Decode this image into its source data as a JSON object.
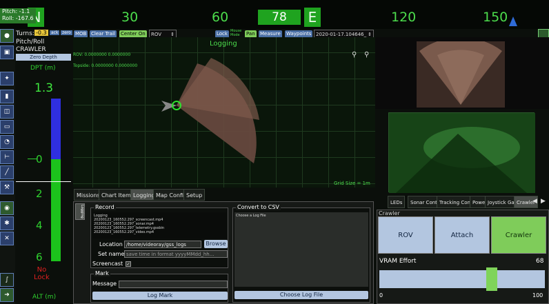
{
  "heading": {
    "ticks": [
      "N",
      "30",
      "60",
      "78",
      "E",
      "120",
      "150"
    ],
    "current": "78"
  },
  "pitchroll": {
    "pitch": "Pitch: -1.1",
    "roll": "Roll: -167.6"
  },
  "top_left": {
    "turns_label": "Turns:",
    "turns_value": "-0.3",
    "ack": "ack",
    "zero": "zero",
    "pitch_roll_label": "Pitch/Roll",
    "crawler_label": "CRAWLER",
    "zero_depth": "Zero Depth",
    "dpt_label": "DPT (m)",
    "depth_value": "1.3",
    "no_lock": "No\nLock",
    "alt_label": "ALT (m)",
    "scale_ticks": [
      "0",
      "2",
      "4",
      "6"
    ]
  },
  "toolbar": {
    "mob": "MOB",
    "clear_trail": "Clear Trail",
    "center_on": "Center On",
    "rov_select": "ROV",
    "lock": "Lock",
    "mouse_mode": "Mouse\nMode",
    "pan": "Pan",
    "measure": "Measure",
    "waypoints": "Waypoints",
    "log_select": "2020-01-17.104646_"
  },
  "map": {
    "logging": "Logging",
    "rov_coords": "ROV: 0.0000000 0.0000000",
    "topside_coords": "Topside: 0.0000000 0.0000000",
    "grid_size": "Grid Size = 1m"
  },
  "tabs": [
    "Missions",
    "Chart Items",
    "Logging",
    "Map Config",
    "Setup"
  ],
  "active_tab": "Logging",
  "logging": {
    "side_tab": "Logging",
    "record_title": "Record",
    "file_list": [
      "Logging",
      "20200123_160552.297_screencast.mp4",
      "20200123_160552.297_sonar.mp4",
      "20200123_160552.297_telemetry.gssbin",
      "20200123_160552.297_video.mp4"
    ],
    "location_label": "Location",
    "location_value": "/home/videoray/gss_logs",
    "browse": "Browse",
    "setname_label": "Set name",
    "setname_placeholder": "save time in format yyyyMMdd_hh...",
    "screencast_label": "Screencast",
    "mark_title": "Mark",
    "message_label": "Message",
    "log_mark": "Log Mark",
    "csv_title": "Convert to CSV",
    "choose_label": "Choose a Log File",
    "choose_button": "Choose Log File"
  },
  "right": {
    "tabs": [
      "LEDs",
      "Sonar Control",
      "Tracking Control",
      "Power",
      "Joystick Gains",
      "Crawler"
    ],
    "active_tab": "Crawler",
    "crawler_title": "Crawler",
    "buttons": [
      "ROV",
      "Attach",
      "Crawler"
    ],
    "effort_label": "VRAM Effort",
    "effort_value": "68",
    "slider_min": "0",
    "slider_max": "100",
    "slider_fraction": 0.68
  }
}
